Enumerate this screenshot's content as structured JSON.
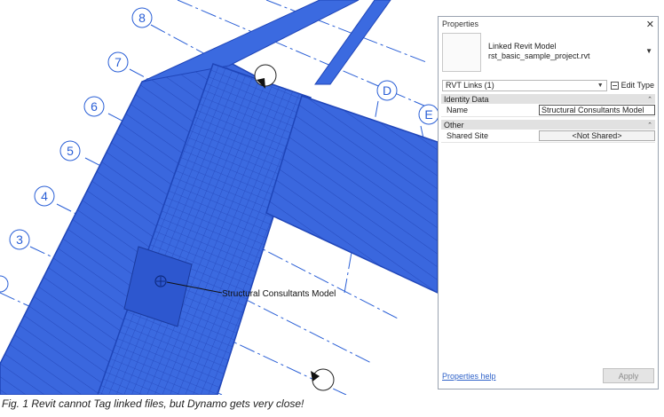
{
  "viewport": {
    "grid_labels": [
      "8",
      "7",
      "6",
      "5",
      "4",
      "3",
      "D",
      "E"
    ],
    "tag_label": "Structural Consultants Model",
    "colors": {
      "model_fill": "#3b6ae0",
      "model_dark": "#1f45b8",
      "grid_line": "#2a5fd6"
    }
  },
  "properties": {
    "title": "Properties",
    "type_name": "Linked Revit Model",
    "type_file": "rst_basic_sample_project.rvt",
    "selector_value": "RVT Links (1)",
    "edit_type_label": "Edit Type",
    "sections": [
      {
        "name": "Identity Data",
        "rows": [
          {
            "label": "Name",
            "value": "Structural Consultants Model"
          }
        ]
      },
      {
        "name": "Other",
        "rows": [
          {
            "label": "Shared Site",
            "value": "<Not Shared>"
          }
        ]
      }
    ],
    "help_link": "Properties help",
    "apply_label": "Apply"
  },
  "caption": "Fig. 1 Revit cannot Tag linked files, but Dynamo gets very close!"
}
